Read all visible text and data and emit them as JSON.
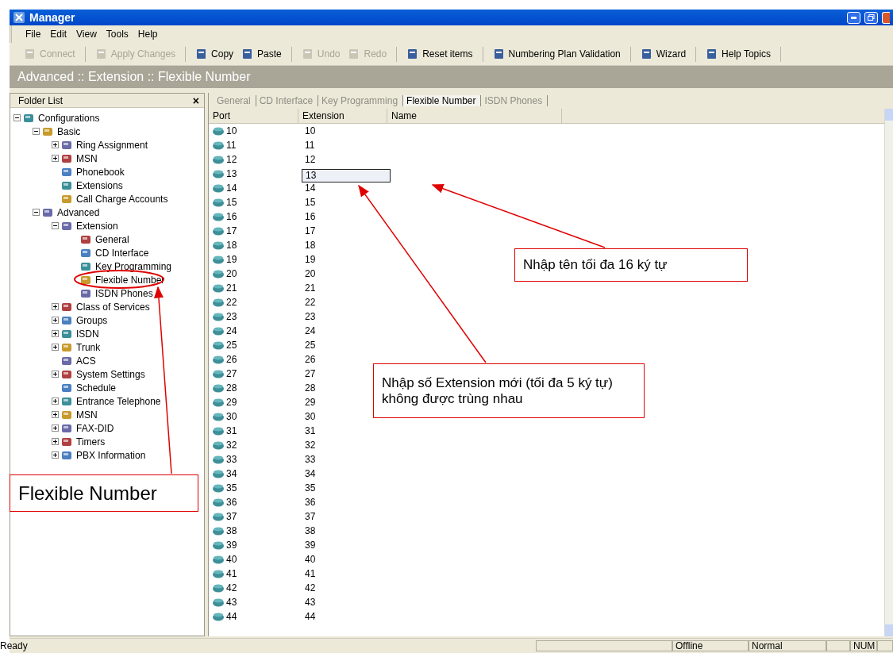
{
  "window": {
    "title": "Manager"
  },
  "menu": [
    "File",
    "Edit",
    "View",
    "Tools",
    "Help"
  ],
  "toolbar": [
    {
      "buttons": [
        {
          "label": "Connect",
          "disabled": true
        }
      ]
    },
    {
      "buttons": [
        {
          "label": "Apply Changes",
          "disabled": true
        }
      ]
    },
    {
      "buttons": [
        {
          "label": "Copy",
          "disabled": false
        },
        {
          "label": "Paste",
          "disabled": false
        }
      ]
    },
    {
      "buttons": [
        {
          "label": "Undo",
          "disabled": true
        },
        {
          "label": "Redo",
          "disabled": true
        }
      ]
    },
    {
      "buttons": [
        {
          "label": "Reset items",
          "disabled": false
        }
      ]
    },
    {
      "buttons": [
        {
          "label": "Numbering Plan Validation",
          "disabled": false
        }
      ]
    },
    {
      "buttons": [
        {
          "label": "Wizard",
          "disabled": false
        }
      ]
    },
    {
      "buttons": [
        {
          "label": "Help Topics",
          "disabled": false
        }
      ]
    }
  ],
  "breadcrumb": "Advanced :: Extension :: Flexible Number",
  "folder_list": {
    "title": "Folder List",
    "close": "×",
    "tree": [
      {
        "label": "Configurations",
        "expanded": true,
        "children": [
          {
            "label": "Basic",
            "expanded": true,
            "children": [
              {
                "label": "Ring Assignment",
                "expanded": false
              },
              {
                "label": "MSN",
                "expanded": false
              },
              {
                "label": "Phonebook"
              },
              {
                "label": "Extensions"
              },
              {
                "label": "Call Charge Accounts"
              }
            ]
          },
          {
            "label": "Advanced",
            "expanded": true,
            "children": [
              {
                "label": "Extension",
                "expanded": true,
                "children": [
                  {
                    "label": "General"
                  },
                  {
                    "label": "CD Interface"
                  },
                  {
                    "label": "Key Programming"
                  },
                  {
                    "label": "Flexible Number"
                  },
                  {
                    "label": "ISDN Phones"
                  }
                ]
              },
              {
                "label": "Class of Services",
                "expanded": false
              },
              {
                "label": "Groups",
                "expanded": false
              },
              {
                "label": "ISDN",
                "expanded": false
              },
              {
                "label": "Trunk",
                "expanded": false
              },
              {
                "label": "ACS"
              },
              {
                "label": "System Settings",
                "expanded": false
              },
              {
                "label": "Schedule"
              },
              {
                "label": "Entrance Telephone",
                "expanded": false
              },
              {
                "label": "MSN",
                "expanded": false
              },
              {
                "label": "FAX-DID",
                "expanded": false
              },
              {
                "label": "Timers",
                "expanded": false
              },
              {
                "label": "PBX Information",
                "expanded": false
              }
            ]
          }
        ]
      }
    ]
  },
  "tabs": [
    {
      "label": "General",
      "selected": false
    },
    {
      "label": "CD Interface",
      "selected": false
    },
    {
      "label": "Key Programming",
      "selected": false
    },
    {
      "label": "Flexible Number",
      "selected": true
    },
    {
      "label": "ISDN Phones",
      "selected": false
    }
  ],
  "table": {
    "columns": [
      "Port",
      "Extension",
      "Name"
    ],
    "rows": [
      {
        "port": "10",
        "extension": "10",
        "editing": false
      },
      {
        "port": "11",
        "extension": "11",
        "editing": false
      },
      {
        "port": "12",
        "extension": "12",
        "editing": false
      },
      {
        "port": "13",
        "extension": "13",
        "editing": true
      },
      {
        "port": "14",
        "extension": "14",
        "editing": false
      },
      {
        "port": "15",
        "extension": "15",
        "editing": false
      },
      {
        "port": "16",
        "extension": "16",
        "editing": false
      },
      {
        "port": "17",
        "extension": "17",
        "editing": false
      },
      {
        "port": "18",
        "extension": "18",
        "editing": false
      },
      {
        "port": "19",
        "extension": "19",
        "editing": false
      },
      {
        "port": "20",
        "extension": "20",
        "editing": false
      },
      {
        "port": "21",
        "extension": "21",
        "editing": false
      },
      {
        "port": "22",
        "extension": "22",
        "editing": false
      },
      {
        "port": "23",
        "extension": "23",
        "editing": false
      },
      {
        "port": "24",
        "extension": "24",
        "editing": false
      },
      {
        "port": "25",
        "extension": "25",
        "editing": false
      },
      {
        "port": "26",
        "extension": "26",
        "editing": false
      },
      {
        "port": "27",
        "extension": "27",
        "editing": false
      },
      {
        "port": "28",
        "extension": "28",
        "editing": false
      },
      {
        "port": "29",
        "extension": "29",
        "editing": false
      },
      {
        "port": "30",
        "extension": "30",
        "editing": false
      },
      {
        "port": "31",
        "extension": "31",
        "editing": false
      },
      {
        "port": "32",
        "extension": "32",
        "editing": false
      },
      {
        "port": "33",
        "extension": "33",
        "editing": false
      },
      {
        "port": "34",
        "extension": "34",
        "editing": false
      },
      {
        "port": "35",
        "extension": "35",
        "editing": false
      },
      {
        "port": "36",
        "extension": "36",
        "editing": false
      },
      {
        "port": "37",
        "extension": "37",
        "editing": false
      },
      {
        "port": "38",
        "extension": "38",
        "editing": false
      },
      {
        "port": "39",
        "extension": "39",
        "editing": false
      },
      {
        "port": "40",
        "extension": "40",
        "editing": false
      },
      {
        "port": "41",
        "extension": "41",
        "editing": false
      },
      {
        "port": "42",
        "extension": "42",
        "editing": false
      },
      {
        "port": "43",
        "extension": "43",
        "editing": false
      },
      {
        "port": "44",
        "extension": "44",
        "editing": false
      }
    ]
  },
  "status_bar": {
    "message": "Ready",
    "panes": [
      "Offline",
      "Normal",
      "NUM"
    ]
  },
  "annotations": [
    {
      "kind": "callout",
      "text": "Flexible Number"
    },
    {
      "kind": "callout",
      "text": "Nhập tên tối đa 16 ký tự"
    },
    {
      "kind": "callout",
      "text": "Nhập số Extension mới (tối đa 5 ký tự) không được trùng nhau"
    }
  ]
}
